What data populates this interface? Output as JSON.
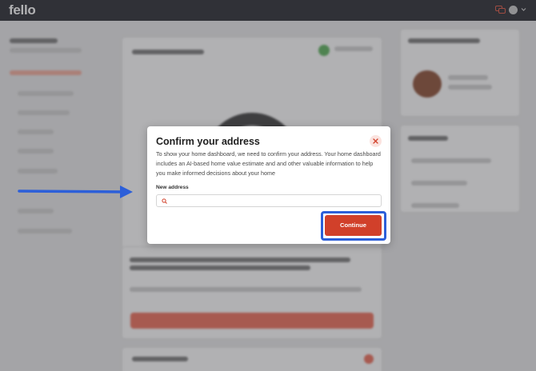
{
  "app": {
    "logo": "fello"
  },
  "modal": {
    "title": "Confirm your address",
    "description": "To show your home dashboard, we need to confirm your address. Your home dashboard includes an AI-based home value estimate and and other valuable information to help you make informed decisions about your home",
    "field_label": "New address",
    "field_value": "",
    "field_placeholder": "",
    "continue_label": "Continue"
  },
  "colors": {
    "topbar": "#22242a",
    "primary_button": "#d1402a",
    "annotation_blue": "#2c5fd9",
    "chat_icon": "#e0523d"
  },
  "icons": [
    "chat-icon",
    "avatar",
    "chevron-down-icon",
    "close-icon",
    "search-icon",
    "arrow-annotation"
  ]
}
